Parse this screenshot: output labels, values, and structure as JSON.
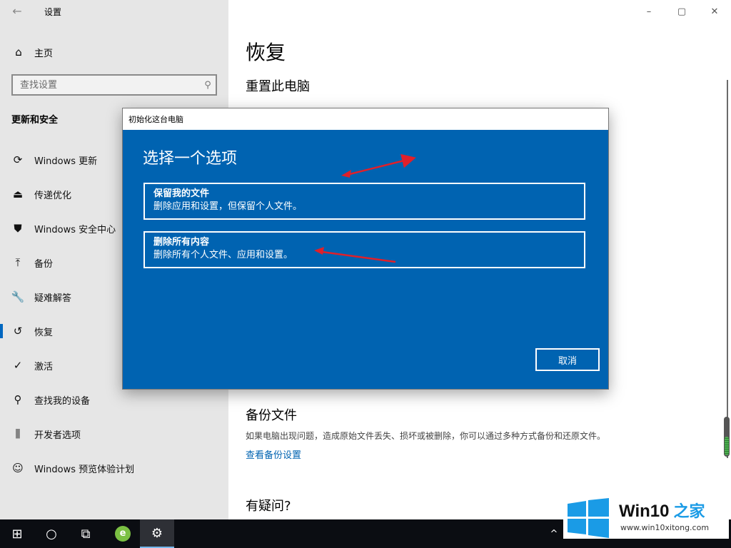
{
  "window": {
    "title": "设置",
    "back_icon": "←",
    "controls": {
      "minimize": "–",
      "maximize": "▢",
      "close": "✕"
    }
  },
  "sidebar": {
    "home": {
      "icon": "⌂",
      "label": "主页"
    },
    "search": {
      "placeholder": "查找设置",
      "icon": "⚲"
    },
    "section_title": "更新和安全",
    "items": [
      {
        "icon": "⟳",
        "label": "Windows 更新",
        "active": false
      },
      {
        "icon": "⏏",
        "label": "传递优化",
        "active": false
      },
      {
        "icon": "⛊",
        "label": "Windows 安全中心",
        "active": false
      },
      {
        "icon": "⤒",
        "label": "备份",
        "active": false
      },
      {
        "icon": "🔧",
        "label": "疑难解答",
        "active": false
      },
      {
        "icon": "↺",
        "label": "恢复",
        "active": true
      },
      {
        "icon": "✓",
        "label": "激活",
        "active": false
      },
      {
        "icon": "⚲",
        "label": "查找我的设备",
        "active": false
      },
      {
        "icon": "⫼",
        "label": "开发者选项",
        "active": false
      },
      {
        "icon": "☺",
        "label": "Windows 预览体验计划",
        "active": false
      }
    ]
  },
  "main": {
    "title": "恢复",
    "reset_heading": "重置此电脑",
    "backup": {
      "title": "备份文件",
      "description": "如果电脑出现问题，造成原始文件丢失、损坏或被删除，你可以通过多种方式备份和还原文件。",
      "link": "查看备份设置"
    },
    "question_title": "有疑问?"
  },
  "dialog": {
    "titlebar": "初始化这台电脑",
    "heading": "选择一个选项",
    "options": [
      {
        "title": "保留我的文件",
        "description": "删除应用和设置，但保留个人文件。"
      },
      {
        "title": "删除所有内容",
        "description": "删除所有个人文件、应用和设置。"
      }
    ],
    "cancel_label": "取消"
  },
  "taskbar": {
    "start_icon": "⊞",
    "search_icon": "○",
    "taskview_icon": "⧉",
    "browser_icon": "e",
    "settings_icon": "⚙",
    "tray_chevron": "^"
  },
  "watermark": {
    "brand": "Win10",
    "brand_accent": "之家",
    "url": "www.win10xitong.com"
  },
  "colors": {
    "accent": "#0063b1",
    "sidebar_bg": "#e6e6e6",
    "annotation_arrow": "#e0202a",
    "taskbar": "#0b0d12"
  }
}
